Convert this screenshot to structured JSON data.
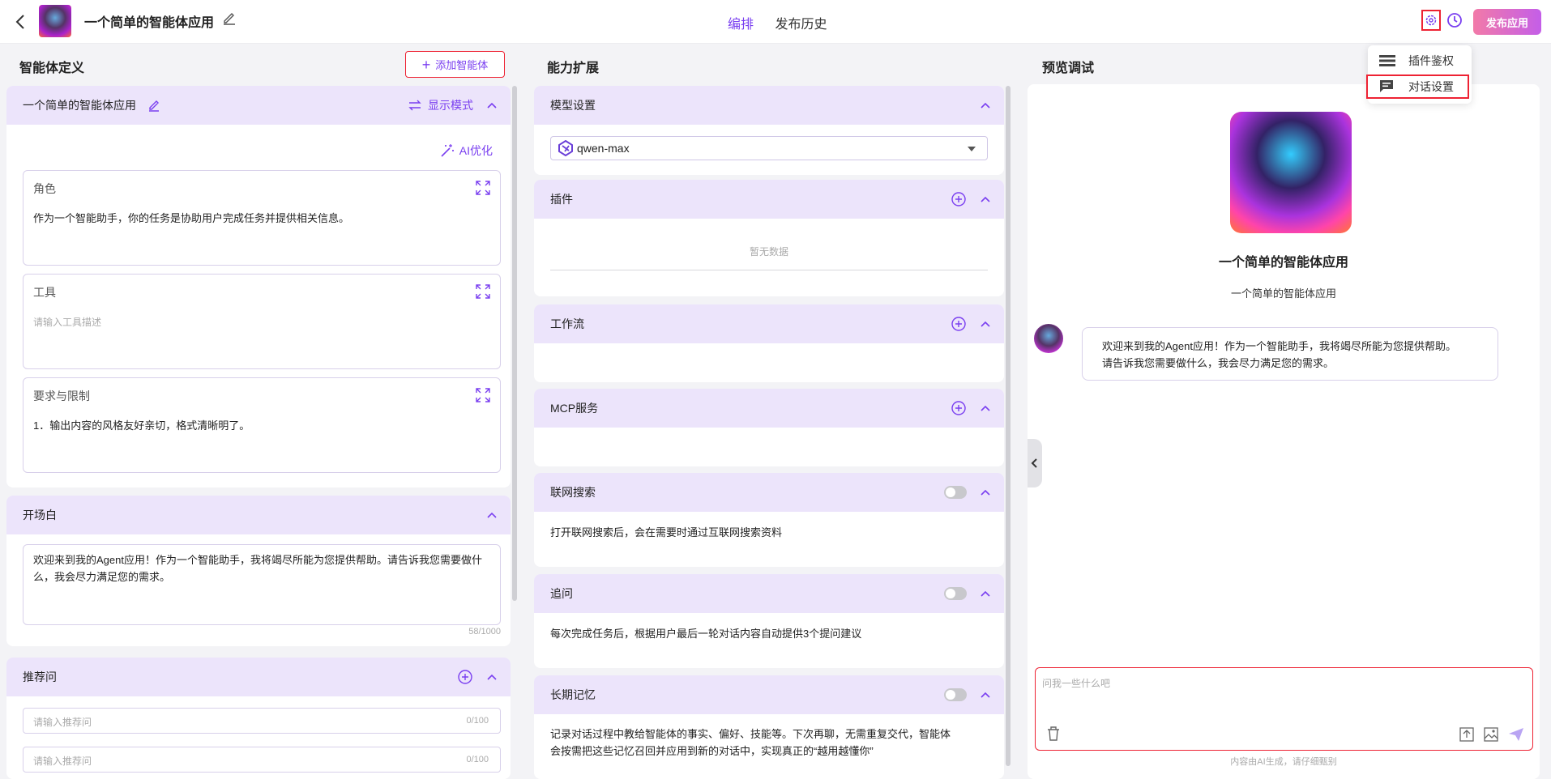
{
  "header": {
    "app_title": "一个简单的智能体应用",
    "tabs": [
      {
        "label": "编排",
        "active": true
      },
      {
        "label": "发布历史",
        "active": false
      }
    ],
    "publish_label": "发布应用"
  },
  "settings_menu": {
    "items": [
      {
        "label": "插件鉴权",
        "icon": "list-icon"
      },
      {
        "label": "对话设置",
        "icon": "chat-icon",
        "highlighted": true
      }
    ]
  },
  "agent_def": {
    "title": "智能体定义",
    "add_agent_label": "添加智能体",
    "agent_name": "一个简单的智能体应用",
    "display_mode_label": "显示模式",
    "ai_optimize_label": "AI优化",
    "role": {
      "label": "角色",
      "value": "作为一个智能助手，你的任务是协助用户完成任务并提供相关信息。"
    },
    "tools": {
      "label": "工具",
      "placeholder": "请输入工具描述"
    },
    "constraints": {
      "label": "要求与限制",
      "value": "1．输出内容的风格友好亲切，格式清晰明了。"
    },
    "opening": {
      "label": "开场白",
      "value": "欢迎来到我的Agent应用！作为一个智能助手，我将竭尽所能为您提供帮助。请告诉我您需要做什么，我会尽力满足您的需求。",
      "count": "58/1000"
    },
    "suggested": {
      "label": "推荐问",
      "placeholder": "请输入推荐问",
      "count": "0/100"
    }
  },
  "capability": {
    "title": "能力扩展",
    "model": {
      "label": "模型设置",
      "value": "qwen-max"
    },
    "plugins": {
      "label": "插件",
      "empty": "暂无数据"
    },
    "workflow": {
      "label": "工作流"
    },
    "mcp": {
      "label": "MCP服务"
    },
    "web_search": {
      "label": "联网搜索",
      "desc": "打开联网搜索后，会在需要时通过互联网搜索资料"
    },
    "follow_up": {
      "label": "追问",
      "desc": "每次完成任务后，根据用户最后一轮对话内容自动提供3个提问建议"
    },
    "memory": {
      "label": "长期记忆",
      "desc1": "记录对话过程中教给智能体的事实、偏好、技能等。下次再聊，无需重复交代，智能体",
      "desc2": "会按需把这些记忆召回并应用到新的对话中，实现真正的“越用越懂你”"
    }
  },
  "preview": {
    "title": "预览调试",
    "bot_name": "一个简单的智能体应用",
    "bot_sub": "一个简单的智能体应用",
    "greeting1": "欢迎来到我的Agent应用！作为一个智能助手，我将竭尽所能为您提供帮助。",
    "greeting2": "请告诉我您需要做什么，我会尽力满足您的需求。",
    "input_placeholder": "问我一些什么吧",
    "disclaimer": "内容由AI生成，请仔细甄别"
  },
  "colors": {
    "accent": "#7a3ff0",
    "panel_head": "#ece4fb",
    "highlight_border": "#e22233"
  }
}
